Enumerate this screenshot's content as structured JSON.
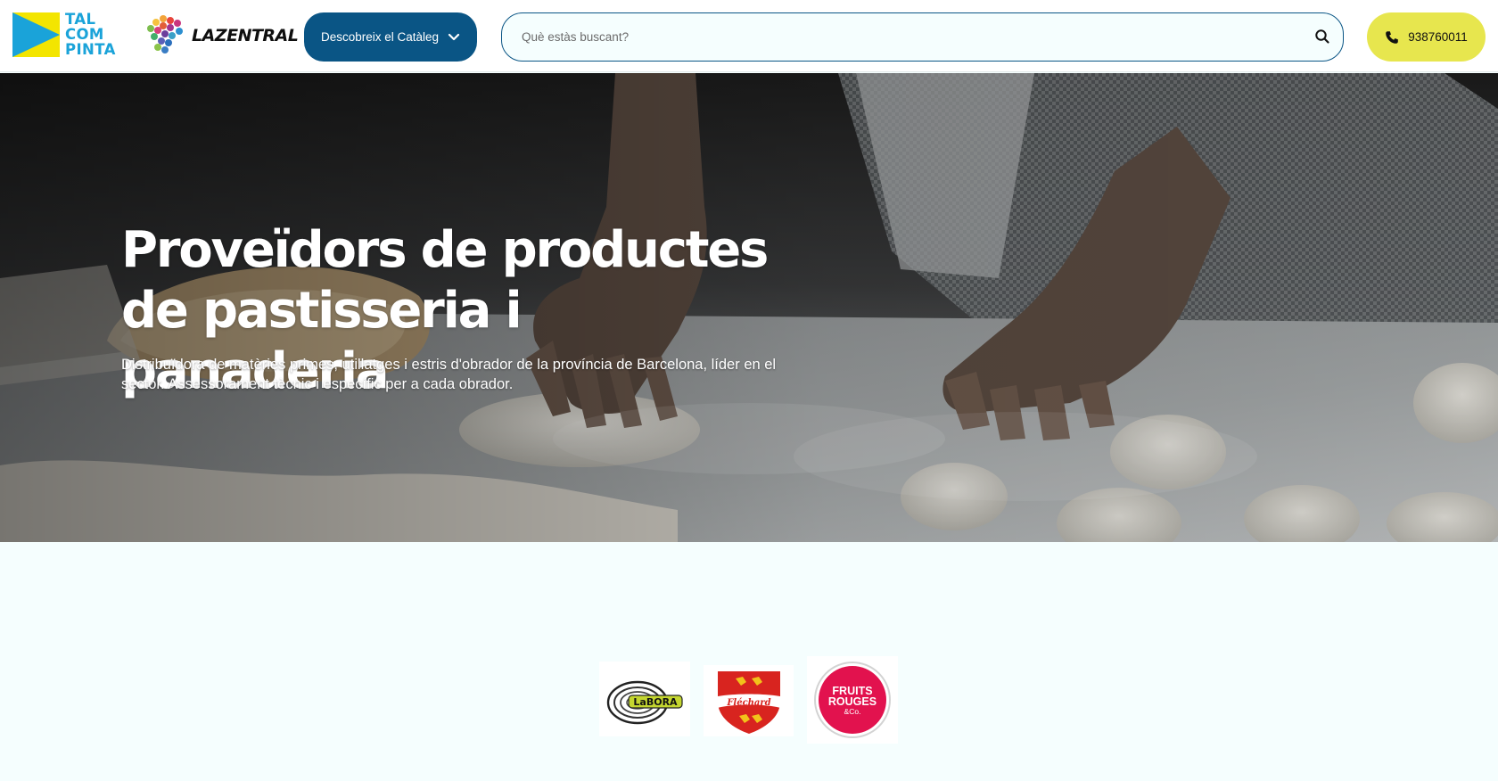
{
  "header": {
    "logo_tal": {
      "line1": "TAL",
      "line2": "COM",
      "line3": "PINTA"
    },
    "logo_lazentral": {
      "text": "LAZENTRAL"
    },
    "catalog_button": {
      "label": "Descobreix el Catàleg",
      "icon": "chevron-down-icon"
    },
    "search": {
      "placeholder": "Què estàs buscant?",
      "value": "",
      "icon": "search-icon"
    },
    "phone_button": {
      "label": "938760011",
      "icon": "phone-icon"
    },
    "colors": {
      "primary": "#0a5585",
      "accent": "#e7e64e",
      "background": "#f5fefe"
    }
  },
  "hero": {
    "title_line1": "Proveïdors de productes",
    "title_line2": "de pastisseria i panaderia",
    "subtitle": "Distribuïdora de matèries primes, utillatges i estris d'obrador de la província de Barcelona, líder en el sector. Assessorament tècnic i específic per a cada obrador."
  },
  "brands": {
    "items": [
      {
        "name": "Labora",
        "text": "LaBORA"
      },
      {
        "name": "Fléchard",
        "text": "Fléchard"
      },
      {
        "name": "Fruits Rouges & Co.",
        "text_line1": "FRUITS",
        "text_line2": "ROUGES",
        "text_line3": "&Co."
      }
    ]
  }
}
